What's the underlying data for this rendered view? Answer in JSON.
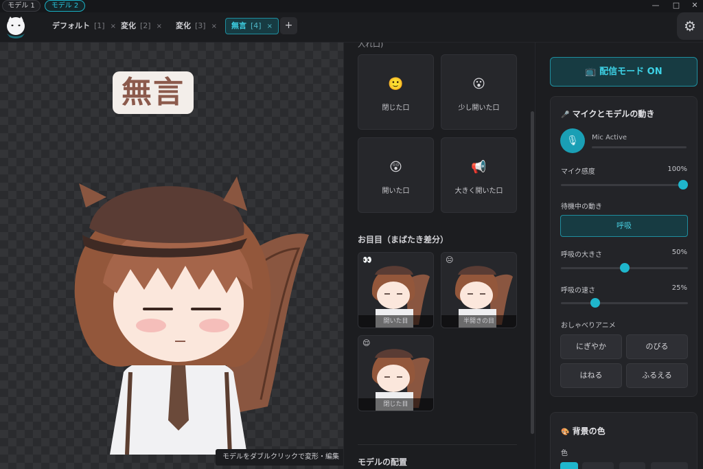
{
  "models": [
    "モデル 1",
    "モデル 2"
  ],
  "window_controls": {
    "minimize": "—",
    "maximize": "□",
    "close": "✕"
  },
  "tabs": [
    {
      "label": "デフォルト",
      "num": "[1]",
      "close": "×"
    },
    {
      "label": "変化",
      "num": "[2]",
      "close": "×"
    },
    {
      "label": "変化",
      "num": "[3]",
      "close": "×"
    },
    {
      "label": "無言",
      "num": "[4]",
      "close": "×"
    }
  ],
  "tab_add": "+",
  "settings_icon": "⚙",
  "canvas": {
    "mode_title": "無言",
    "hint": "モデルをダブルクリックで変形・編集"
  },
  "mouth_section": {
    "cut_header": "入れ口)",
    "cards": [
      {
        "emoji": "🙂",
        "label": "閉じた口"
      },
      {
        "emoji": "😮",
        "label": "少し開いた口"
      },
      {
        "emoji": "😲",
        "label": "開いた口"
      },
      {
        "emoji": "📢",
        "label": "大きく開いた口"
      }
    ]
  },
  "eye_section": {
    "title": "お目目（まばたき差分）",
    "thumbs": [
      {
        "emoji": "👀",
        "label": "開いた目"
      },
      {
        "emoji": "😑",
        "label": "半開きの目"
      },
      {
        "emoji": "😌",
        "label": "閉じた目"
      }
    ]
  },
  "placement_title": "モデルの配置",
  "stream_button": {
    "icon": "📺",
    "label": "配信モード ON"
  },
  "mic_panel": {
    "title": "マイクとモデルの動き",
    "title_icon": "🎤",
    "mic_status": "Mic Active",
    "mic_icon": "🎙",
    "sensitivity_label": "マイク感度",
    "sensitivity_value": "100%",
    "sensitivity": 1.0,
    "idle_label": "待機中の動き",
    "idle_option": "呼吸",
    "breath_size_label": "呼吸の大きさ",
    "breath_size_value": "50%",
    "breath_size": 0.5,
    "breath_speed_label": "呼吸の速さ",
    "breath_speed_value": "25%",
    "breath_speed": 0.25,
    "talk_anim_label": "おしゃべりアニメ",
    "talk_anims": [
      "にぎやか",
      "のびる",
      "はねる",
      "ふるえる"
    ]
  },
  "bg_panel": {
    "title": "背景の色",
    "title_icon": "🎨",
    "color_label": "色"
  },
  "colors": {
    "accent": "#1fb6cc",
    "accent_dark": "#173b42",
    "panel": "#232428"
  }
}
